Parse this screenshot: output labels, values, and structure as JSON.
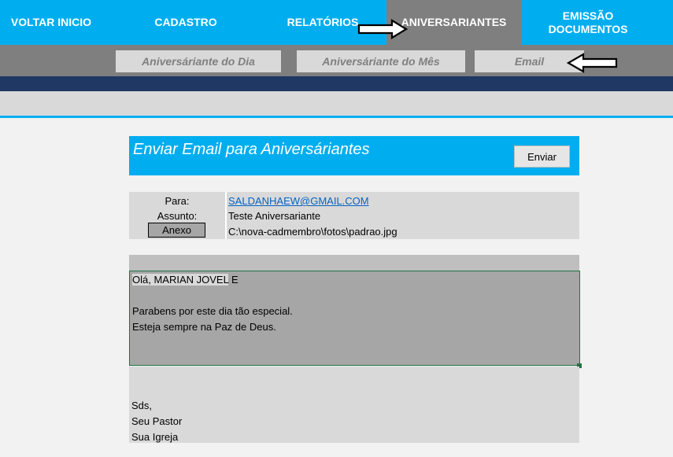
{
  "nav": {
    "voltar": "VOLTAR INICIO",
    "cadastro": "CADASTRO",
    "relatorios": "RELATÓRIOS",
    "aniversariantes": "ANIVERSARIANTES",
    "emissao_line1": "EMISSÃO",
    "emissao_line2": "DOCUMENTOS"
  },
  "subnav": {
    "dia": "Aniversáriante do Dia",
    "mes": "Aniversáriante do Mês",
    "email": "Email"
  },
  "panel": {
    "title": "Enviar Email para Aniversáriantes",
    "send_label": "Enviar"
  },
  "fields": {
    "para_label": "Para:",
    "para_value": "SALDANHAEW@GMAIL.COM",
    "assunto_label": "Assunto:",
    "assunto_value": "Teste Aniversariante",
    "anexo_label": "Anexo",
    "anexo_value": "C:\\nova-cadmembro\\fotos\\padrao.jpg"
  },
  "message": {
    "greeting": "Olá, MARIAN JOVEL",
    "greeting_end": "E",
    "line2": "Parabens por este dia tão especial.",
    "line3": "Esteja sempre na Paz de Deus.",
    "sign1": "Sds,",
    "sign2": "Seu Pastor",
    "sign3": "Sua Igreja"
  },
  "colors": {
    "accent": "#00aeef",
    "nav_active": "#7f7f7f",
    "dark_bar": "#1f3864",
    "selection_border": "#217346"
  },
  "icons": [
    "arrow-right-icon",
    "arrow-left-icon"
  ]
}
